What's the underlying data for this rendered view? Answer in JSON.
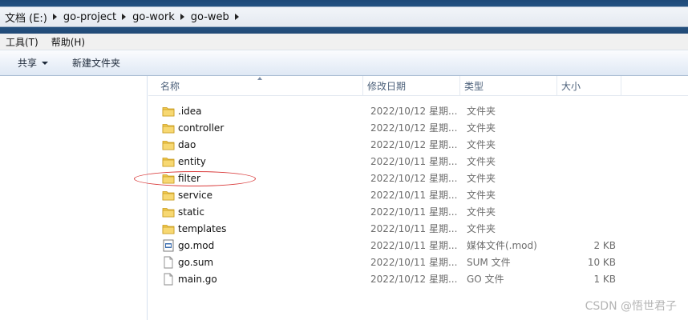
{
  "breadcrumb": {
    "items": [
      "文档 (E:)",
      "go-project",
      "go-work",
      "go-web"
    ]
  },
  "menu": {
    "items": [
      "工具(T)",
      "帮助(H)"
    ]
  },
  "toolbar": {
    "organize_label": "共享",
    "new_folder_label": "新建文件夹"
  },
  "columns": {
    "name": "名称",
    "date": "修改日期",
    "type": "类型",
    "size": "大小"
  },
  "files": [
    {
      "name": ".idea",
      "date": "2022/10/12 星期...",
      "type": "文件夹",
      "size": "",
      "icon": "folder-icon"
    },
    {
      "name": "controller",
      "date": "2022/10/12 星期...",
      "type": "文件夹",
      "size": "",
      "icon": "folder-icon"
    },
    {
      "name": "dao",
      "date": "2022/10/12 星期...",
      "type": "文件夹",
      "size": "",
      "icon": "folder-icon"
    },
    {
      "name": "entity",
      "date": "2022/10/11 星期...",
      "type": "文件夹",
      "size": "",
      "icon": "folder-icon"
    },
    {
      "name": "filter",
      "date": "2022/10/12 星期...",
      "type": "文件夹",
      "size": "",
      "icon": "folder-icon"
    },
    {
      "name": "service",
      "date": "2022/10/11 星期...",
      "type": "文件夹",
      "size": "",
      "icon": "folder-icon"
    },
    {
      "name": "static",
      "date": "2022/10/11 星期...",
      "type": "文件夹",
      "size": "",
      "icon": "folder-icon"
    },
    {
      "name": "templates",
      "date": "2022/10/11 星期...",
      "type": "文件夹",
      "size": "",
      "icon": "folder-icon"
    },
    {
      "name": "go.mod",
      "date": "2022/10/11 星期...",
      "type": "媒体文件(.mod)",
      "size": "2 KB",
      "icon": "media-file-icon"
    },
    {
      "name": "go.sum",
      "date": "2022/10/11 星期...",
      "type": "SUM 文件",
      "size": "10 KB",
      "icon": "document-icon"
    },
    {
      "name": "main.go",
      "date": "2022/10/12 星期...",
      "type": "GO 文件",
      "size": "1 KB",
      "icon": "document-icon"
    }
  ],
  "watermark": "CSDN @悟世君子",
  "colors": {
    "address_bar": "#2a5d8f",
    "folder": "#f2c94c",
    "annotation": "#d93a3a"
  }
}
